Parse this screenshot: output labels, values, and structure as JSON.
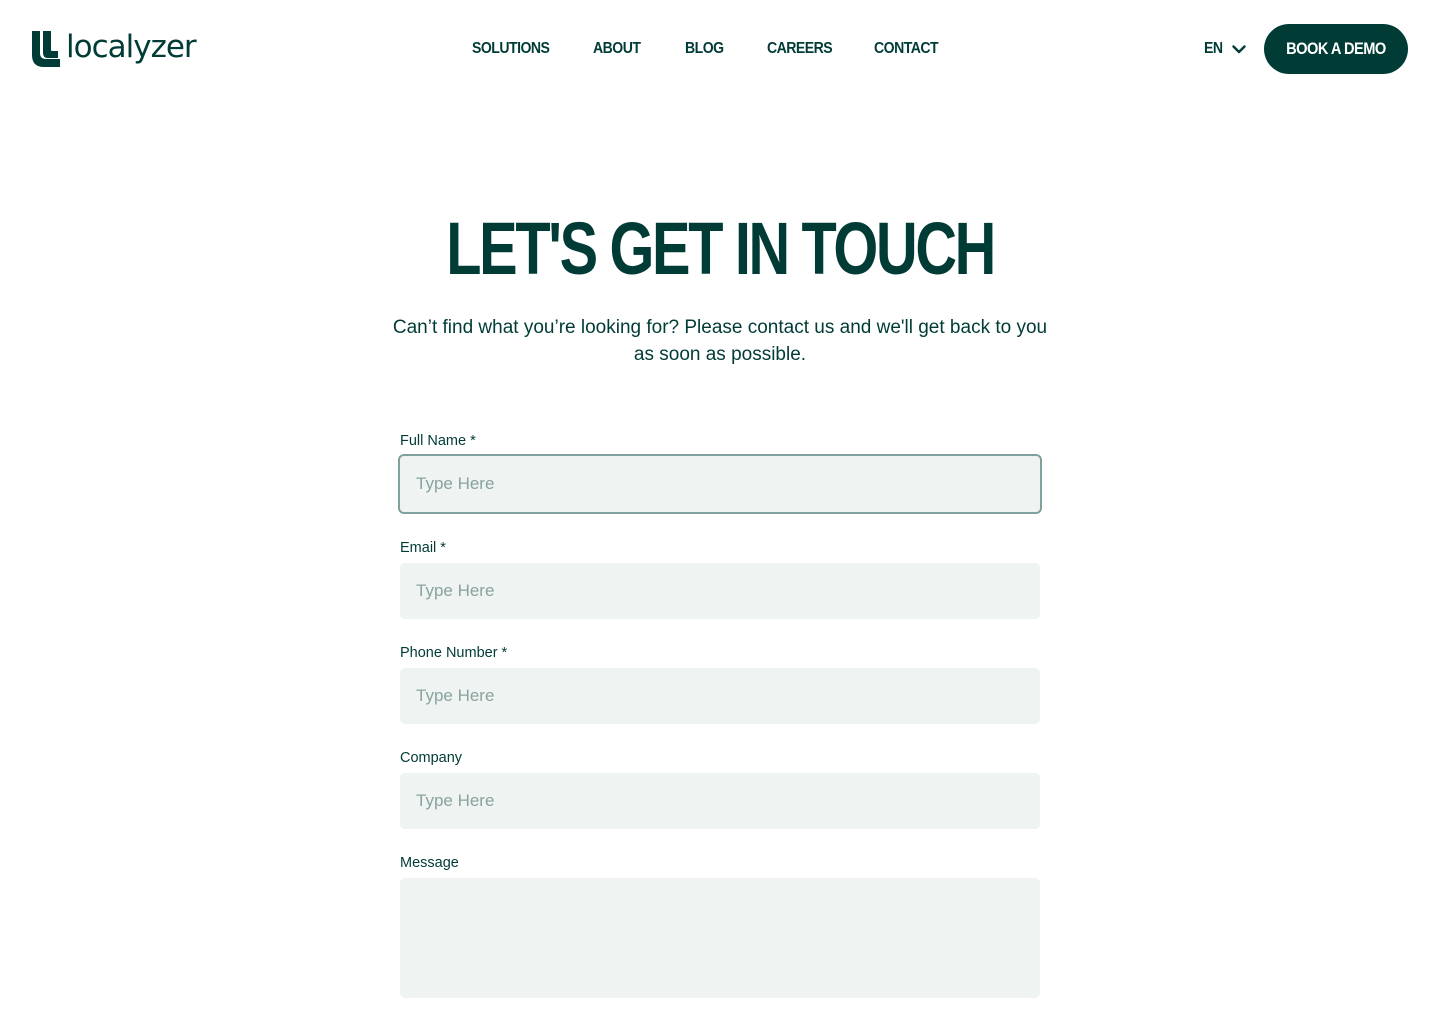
{
  "brand": {
    "name": "localyzer",
    "color": "#003b36"
  },
  "nav": {
    "items": [
      {
        "label": "SOLUTIONS"
      },
      {
        "label": "ABOUT"
      },
      {
        "label": "BLOG"
      },
      {
        "label": "CAREERS"
      },
      {
        "label": "CONTACT"
      }
    ],
    "language": "EN",
    "cta_label": "BOOK A DEMO"
  },
  "hero": {
    "title": "LET'S GET IN TOUCH",
    "subtitle": "Can’t find what you’re looking for? Please contact us and we'll get back to you as soon as possible."
  },
  "form": {
    "fields": [
      {
        "label": "Full Name *",
        "placeholder": "Type Here",
        "focused": true
      },
      {
        "label": "Email *",
        "placeholder": "Type Here"
      },
      {
        "label": "Phone Number *",
        "placeholder": "Type Here"
      },
      {
        "label": "Company",
        "placeholder": "Type Here"
      },
      {
        "label": "Message",
        "placeholder": ""
      }
    ]
  },
  "icons": {
    "logo": "localyzer-logo-icon",
    "language_dropdown": "chevron-down-icon"
  },
  "colors": {
    "primary": "#003b36",
    "input_background": "#eff3f1",
    "focus_border": "#7fa09c",
    "placeholder": "#88a3a0"
  }
}
